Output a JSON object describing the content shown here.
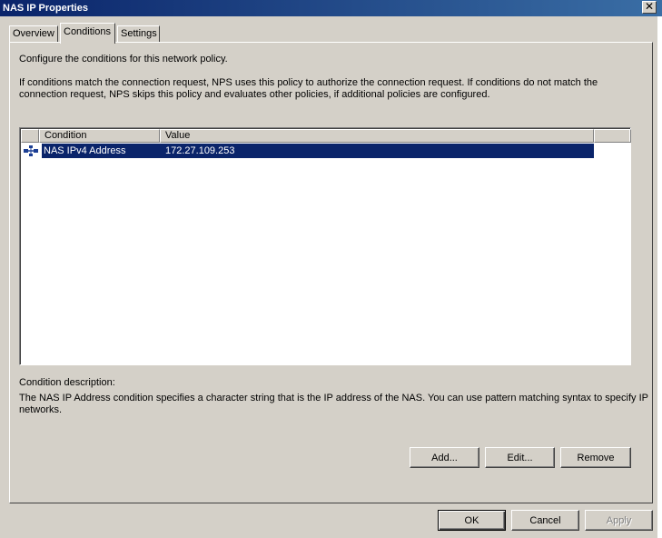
{
  "window": {
    "title": "NAS IP Properties",
    "close": "✕"
  },
  "tabs": [
    {
      "label": "Overview",
      "active": false
    },
    {
      "label": "Conditions",
      "active": true
    },
    {
      "label": "Settings",
      "active": false
    }
  ],
  "intro": "Configure the conditions for this network policy.",
  "explanation_line1": "If conditions match the connection request, NPS uses this policy to authorize the connection request. If conditions do not match the",
  "explanation_line2": "connection request, NPS skips this policy and evaluates other policies, if additional policies are configured.",
  "table": {
    "columns": [
      "Condition",
      "Value"
    ],
    "rows": [
      {
        "icon": "network-condition-icon",
        "condition": "NAS IPv4 Address",
        "value": "172.27.109.253",
        "selected": true
      }
    ]
  },
  "description": {
    "label": "Condition description:",
    "line1": "The NAS IP Address condition specifies a character string that is the IP address of the NAS. You can use pattern matching syntax to specify IP",
    "line2": "networks."
  },
  "buttons": {
    "add": "Add...",
    "edit": "Edit...",
    "remove": "Remove",
    "ok": "OK",
    "cancel": "Cancel",
    "apply": "Apply"
  },
  "colors": {
    "titlebar": "#0a246a",
    "selection": "#0a246a",
    "face": "#d4d0c8"
  }
}
